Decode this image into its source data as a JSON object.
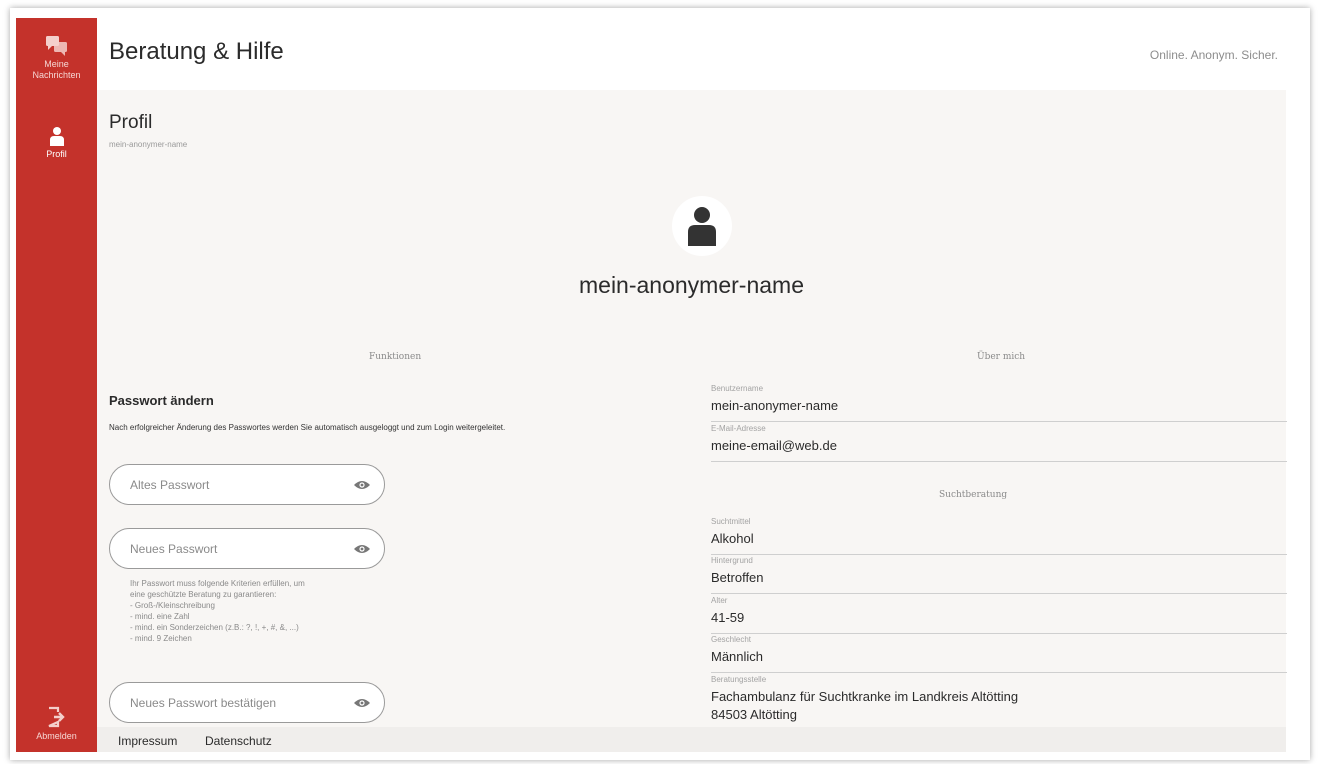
{
  "header": {
    "title": "Beratung & Hilfe",
    "tagline": "Online. Anonym. Sicher."
  },
  "sidebar": {
    "items": [
      {
        "label": "Meine Nachrichten",
        "icon": "messages-icon"
      },
      {
        "label": "Profil",
        "icon": "person-icon"
      }
    ],
    "logout": {
      "label": "Abmelden",
      "icon": "logout-icon"
    }
  },
  "page": {
    "title": "Profil",
    "subtitle": "mein-anonymer-name"
  },
  "profile": {
    "name": "mein-anonymer-name"
  },
  "sections": {
    "functions": "Funktionen",
    "about": "Über mich",
    "addiction": "Suchtberatung"
  },
  "password": {
    "title": "Passwort ändern",
    "description": "Nach erfolgreicher Änderung des Passwortes werden Sie automatisch ausgeloggt und zum Login weitergeleitet.",
    "old_placeholder": "Altes Passwort",
    "new_placeholder": "Neues Passwort",
    "confirm_placeholder": "Neues Passwort bestätigen",
    "hint": "Ihr Passwort muss folgende Kriterien erfüllen, um\neine geschützte Beratung zu garantieren:\n- Groß-/Kleinschreibung\n- mind. eine Zahl\n- mind. ein Sonderzeichen (z.B.: ?, !, +, #, &, ...)\n- mind. 9 Zeichen"
  },
  "about": {
    "username_label": "Benutzername",
    "username": "mein-anonymer-name",
    "email_label": "E-Mail-Adresse",
    "email": "meine-email@web.de"
  },
  "addiction": {
    "substance_label": "Suchtmittel",
    "substance": "Alkohol",
    "background_label": "Hintergrund",
    "background": "Betroffen",
    "age_label": "Alter",
    "age": "41-59",
    "gender_label": "Geschlecht",
    "gender": "Männlich",
    "agency_label": "Beratungsstelle",
    "agency_name": "Fachambulanz für Suchtkranke im Landkreis Altötting",
    "agency_city": "84503 Altötting"
  },
  "footer": {
    "imprint": "Impressum",
    "privacy": "Datenschutz"
  },
  "colors": {
    "sidebar": "#c4322b",
    "background": "#f8f6f4",
    "text": "#2b2b2b"
  }
}
